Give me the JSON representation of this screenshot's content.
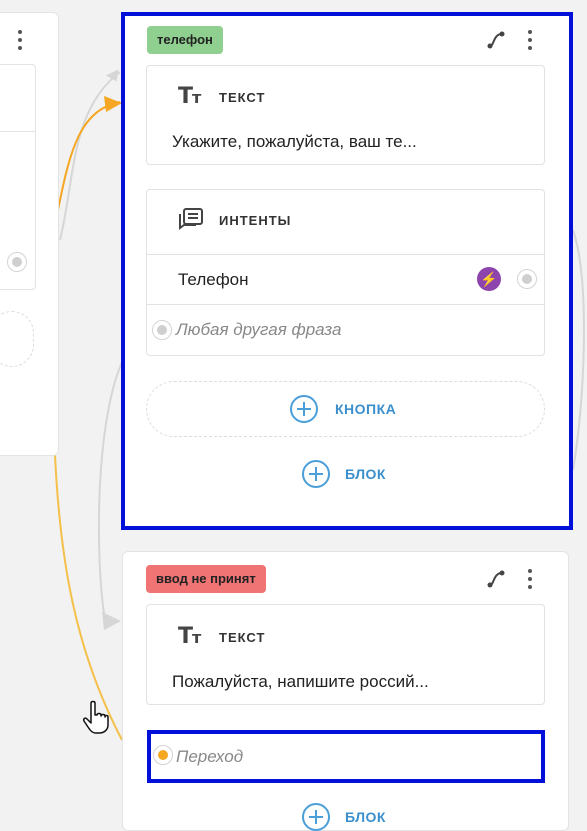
{
  "card1": {
    "badge": "телефон",
    "badge_color": "#8fcf8f",
    "text_block": {
      "header": "ТЕКСТ",
      "message": "Укажите, пожалуйста, ваш те..."
    },
    "intents_block": {
      "header": "ИНТЕНТЫ",
      "items": [
        "Телефон"
      ],
      "fallback": "Любая другая фраза"
    },
    "button_label": "КНОПКА",
    "add_block_label": "БЛОК"
  },
  "card2": {
    "badge": "ввод не принят",
    "badge_color": "#f07474",
    "text_block": {
      "header": "ТЕКСТ",
      "message": "Пожалуйста, напишите россий..."
    },
    "transition_placeholder": "Переход",
    "add_block_label": "БЛОК"
  },
  "icons": {
    "text": "Tт",
    "bolt": "⚡"
  },
  "colors": {
    "highlight": "#0010d8",
    "accent": "#4a9fd8",
    "orange": "#f5a623"
  }
}
